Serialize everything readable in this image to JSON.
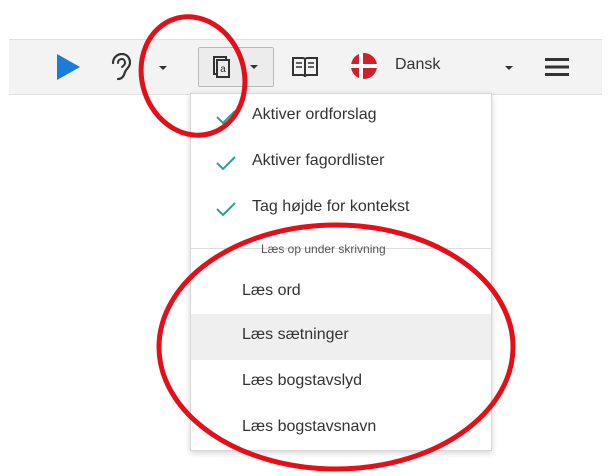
{
  "toolbar": {
    "play": "play-icon",
    "listen": "ear-icon",
    "word_prediction": "word-prediction-icon",
    "dictionary": "book-icon",
    "language_label": "Dansk",
    "language_flag": "danish-flag-icon",
    "menu": "hamburger-menu-icon"
  },
  "dropdown": {
    "checked_items": [
      {
        "label": "Aktiver ordforslag",
        "checked": true
      },
      {
        "label": "Aktiver fagordlister",
        "checked": true
      },
      {
        "label": "Tag højde for kontekst",
        "checked": true
      }
    ],
    "section_title": "Læs op under skrivning",
    "read_items": [
      {
        "label": "Læs ord"
      },
      {
        "label": "Læs sætninger"
      },
      {
        "label": "Læs bogstavslyd"
      },
      {
        "label": "Læs bogstavsnavn"
      }
    ],
    "hovered_item": "Læs sætninger"
  },
  "colors": {
    "play": "#1a7ddc",
    "check": "#2aa198",
    "flag_red": "#d0202a",
    "annotation_red": "#e3101a",
    "toolbar_bg": "#f3f3f3"
  }
}
